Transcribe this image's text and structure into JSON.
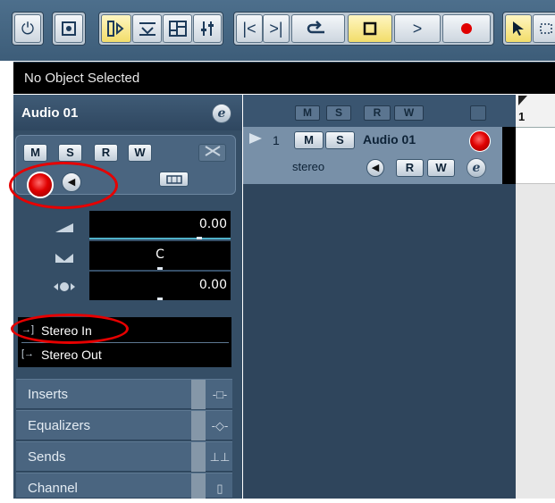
{
  "toolbar": {
    "power_icon": "power-icon",
    "constrain_icon": "constrain-delay-icon",
    "view_buttons": [
      "inspector-icon",
      "info-line-icon",
      "overview-icon",
      "mixer-icon"
    ],
    "transport": {
      "go_to_start": "|<",
      "go_to_end": ">|",
      "cycle": "cycle-icon",
      "stop": "stop-icon",
      "play": ">",
      "record": "record-icon"
    },
    "tools": [
      "arrow-tool-icon",
      "range-tool-icon"
    ]
  },
  "info_line": {
    "text": "No Object Selected"
  },
  "inspector": {
    "track_name": "Audio 01",
    "edit_button": "e",
    "buttons": {
      "mute": "M",
      "solo": "S",
      "read": "R",
      "write": "W"
    },
    "volume": "0.00",
    "pan": "C",
    "delay": "0.00",
    "input_routing": "Stereo In",
    "output_routing": "Stereo Out",
    "sections": [
      {
        "label": "Inserts",
        "icon": "inserts-icon"
      },
      {
        "label": "Equalizers",
        "icon": "equalizer-icon"
      },
      {
        "label": "Sends",
        "icon": "sends-icon"
      },
      {
        "label": "Channel",
        "icon": "channel-icon"
      }
    ]
  },
  "track_list": {
    "header_buttons": [
      "M",
      "S",
      "R",
      "W"
    ],
    "tracks": [
      {
        "number": "1",
        "name": "Audio 01",
        "type": "stereo",
        "mute": "M",
        "solo": "S",
        "read": "R",
        "write": "W",
        "edit": "e"
      }
    ]
  },
  "ruler": {
    "bar": "1"
  },
  "annotations": {
    "highlight_color": "#e60000"
  }
}
